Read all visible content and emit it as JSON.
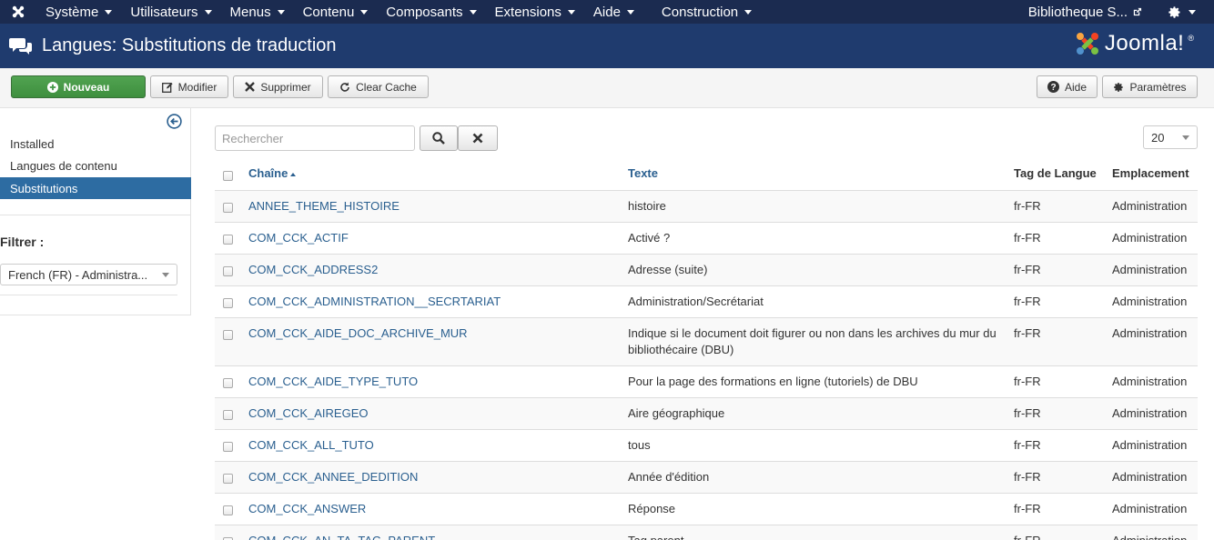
{
  "topnav": {
    "menu": [
      {
        "label": "Système"
      },
      {
        "label": "Utilisateurs"
      },
      {
        "label": "Menus"
      },
      {
        "label": "Contenu"
      },
      {
        "label": "Composants"
      },
      {
        "label": "Extensions"
      },
      {
        "label": "Aide"
      },
      {
        "label": "Construction"
      }
    ],
    "site_link": "Bibliotheque S..."
  },
  "header": {
    "title": "Langues: Substitutions de traduction",
    "brand": "Joomla!",
    "brand_mark": "®"
  },
  "toolbar": {
    "new_label": "Nouveau",
    "edit_label": "Modifier",
    "delete_label": "Supprimer",
    "clear_cache_label": "Clear Cache",
    "help_label": "Aide",
    "options_label": "Paramètres"
  },
  "sidebar": {
    "items": [
      {
        "label": "Installed"
      },
      {
        "label": "Langues de contenu"
      },
      {
        "label": "Substitutions"
      }
    ],
    "filter_label": "Filtrer :",
    "filter_value": "French (FR) - Administra..."
  },
  "search": {
    "placeholder": "Rechercher"
  },
  "list_limit": "20",
  "table": {
    "headers": {
      "key": "Chaîne",
      "text": "Texte",
      "tag": "Tag de Langue",
      "location": "Emplacement"
    },
    "rows": [
      {
        "key": "ANNEE_THEME_HISTOIRE",
        "text": "histoire",
        "tag": "fr-FR",
        "location": "Administration"
      },
      {
        "key": "COM_CCK_ACTIF",
        "text": "Activé ?",
        "tag": "fr-FR",
        "location": "Administration"
      },
      {
        "key": "COM_CCK_ADDRESS2",
        "text": "Adresse (suite)",
        "tag": "fr-FR",
        "location": "Administration"
      },
      {
        "key": "COM_CCK_ADMINISTRATION__SECRTARIAT",
        "text": "Administration/Secrétariat",
        "tag": "fr-FR",
        "location": "Administration"
      },
      {
        "key": "COM_CCK_AIDE_DOC_ARCHIVE_MUR",
        "text": "Indique si le document doit figurer ou non dans les archives du mur du bibliothécaire (DBU)",
        "tag": "fr-FR",
        "location": "Administration"
      },
      {
        "key": "COM_CCK_AIDE_TYPE_TUTO",
        "text": "Pour la page des formations en ligne (tutoriels) de DBU",
        "tag": "fr-FR",
        "location": "Administration"
      },
      {
        "key": "COM_CCK_AIREGEO",
        "text": "Aire géographique",
        "tag": "fr-FR",
        "location": "Administration"
      },
      {
        "key": "COM_CCK_ALL_TUTO",
        "text": "tous",
        "tag": "fr-FR",
        "location": "Administration"
      },
      {
        "key": "COM_CCK_ANNEE_DEDITION",
        "text": "Année d'édition",
        "tag": "fr-FR",
        "location": "Administration"
      },
      {
        "key": "COM_CCK_ANSWER",
        "text": "Réponse",
        "tag": "fr-FR",
        "location": "Administration"
      },
      {
        "key": "COM_CCK_AN_TA_TAG_PARENT",
        "text": "Tag parent",
        "tag": "fr-FR",
        "location": "Administration"
      }
    ]
  }
}
